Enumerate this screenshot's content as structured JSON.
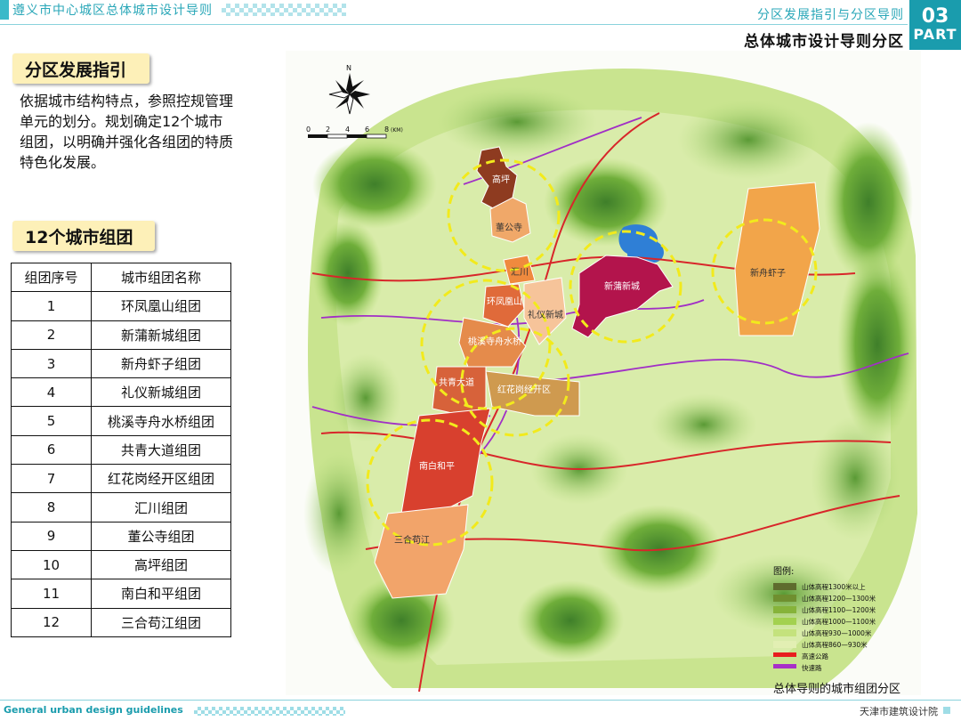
{
  "header": {
    "doc_title": "遵义市中心城区总体城市设计导则",
    "sub_title": "分区发展指引与分区导则",
    "main_title": "总体城市设计导则分区",
    "part_number": "03",
    "part_label": "PART"
  },
  "section1": {
    "heading": "分区发展指引",
    "paragraph": "依据城市结构特点，参照控规管理单元的划分。规划确定12个城市组团，以明确并强化各组团的特质特色化发展。"
  },
  "section2": {
    "heading": "12个城市组团",
    "table": {
      "headers": [
        "组团序号",
        "城市组团名称"
      ],
      "rows": [
        [
          "1",
          "环凤凰山组团"
        ],
        [
          "2",
          "新蒲新城组团"
        ],
        [
          "3",
          "新舟虾子组团"
        ],
        [
          "4",
          "礼仪新城组团"
        ],
        [
          "5",
          "桃溪寺舟水桥组团"
        ],
        [
          "6",
          "共青大道组团"
        ],
        [
          "7",
          "红花岗经开区组团"
        ],
        [
          "8",
          "汇川组团"
        ],
        [
          "9",
          "董公寺组团"
        ],
        [
          "10",
          "高坪组团"
        ],
        [
          "11",
          "南白和平组团"
        ],
        [
          "12",
          "三合苟江组团"
        ]
      ]
    }
  },
  "map": {
    "caption": "总体导则的城市组团分区",
    "compass_label": "N",
    "scale_ticks": [
      "0",
      "2",
      "4",
      "6",
      "8"
    ],
    "scale_unit": "(KM)",
    "zone_labels": [
      "高坪",
      "董公寺",
      "汇川",
      "环凤凰山",
      "礼仪新城",
      "新蒲新城",
      "新舟虾子",
      "桃溪寺舟水桥",
      "共青大道",
      "红花岗经开区",
      "南白和平",
      "三合苟江"
    ],
    "legend": {
      "title": "图例:",
      "items": [
        {
          "label": "山体高程1300米以上",
          "color": "#5e6b2e"
        },
        {
          "label": "山体高程1200—1300米",
          "color": "#6f8f2f"
        },
        {
          "label": "山体高程1100—1200米",
          "color": "#86b33a"
        },
        {
          "label": "山体高程1000—1100米",
          "color": "#a3d14f"
        },
        {
          "label": "山体高程930—1000米",
          "color": "#c4e27d"
        },
        {
          "label": "山体高程860—930米",
          "color": "#e2efb3"
        },
        {
          "label": "高速公路",
          "color": "#e81e1e"
        },
        {
          "label": "快速路",
          "color": "#a82fc8"
        }
      ]
    }
  },
  "footer": {
    "english": "General urban design guidelines",
    "org": "天津市建筑设计院"
  }
}
